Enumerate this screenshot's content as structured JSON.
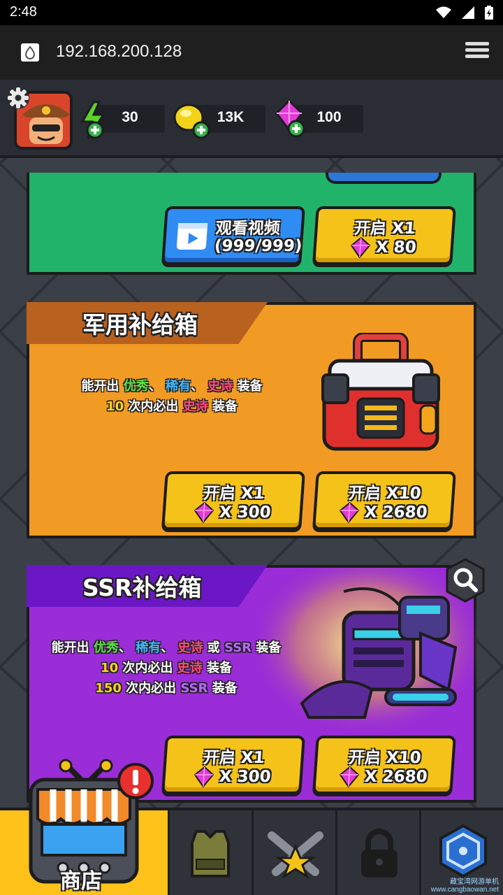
{
  "status_bar": {
    "time": "2:48"
  },
  "browser": {
    "url": "192.168.200.128"
  },
  "hud": {
    "energy": "30",
    "gold": "13K",
    "gems": "100"
  },
  "green_box": {
    "video_button": {
      "title": "观看视频",
      "count": "(999/999)"
    },
    "open_x1": {
      "label": "开启 X1",
      "cost": "X 80"
    }
  },
  "military_box": {
    "title": "军用补给箱",
    "desc_line1_prefix": "能开出",
    "desc_good": "优秀",
    "desc_sep1": "、",
    "desc_rare": "稀有",
    "desc_sep2": "、",
    "desc_epic": "史诗",
    "desc_line1_suffix": "装备",
    "desc_line2_num": "10",
    "desc_line2_mid": "次内必出",
    "desc_line2_epic": "史诗",
    "desc_line2_suffix": "装备",
    "open_x1": {
      "label": "开启 X1",
      "cost": "X 300"
    },
    "open_x10": {
      "label": "开启 X10",
      "cost": "X 2680"
    }
  },
  "ssr_box": {
    "title": "SSR补给箱",
    "desc_line1_prefix": "能开出",
    "desc_good": "优秀",
    "desc_sep1": "、",
    "desc_rare": "稀有",
    "desc_sep2": "、",
    "desc_epic": "史诗",
    "desc_or": "或",
    "desc_ssr": "SSR",
    "desc_line1_suffix": "装备",
    "desc_line2_num": "10",
    "desc_line2_mid": "次内必出",
    "desc_line2_epic": "史诗",
    "desc_line2_suffix": "装备",
    "desc_line3_num": "150",
    "desc_line3_mid": "次内必出",
    "desc_line3_ssr": "SSR",
    "desc_line3_suffix": "装备",
    "open_x1": {
      "label": "开启 X1",
      "cost": "X 300"
    },
    "open_x10": {
      "label": "开启 X10",
      "cost": "X 2680"
    }
  },
  "bottom_nav": {
    "shop_label": "商店",
    "watermark_line1": "藏宝湾网游单机",
    "watermark_line2": "www.cangbaowan.net"
  },
  "colors": {
    "green_panel": "#22b36b",
    "orange_panel": "#f29b24",
    "purple_panel": "#9a2dd7",
    "button_yellow": "#f5c21a",
    "button_blue": "#2f8cf2",
    "nav_active": "#ffc21a"
  }
}
